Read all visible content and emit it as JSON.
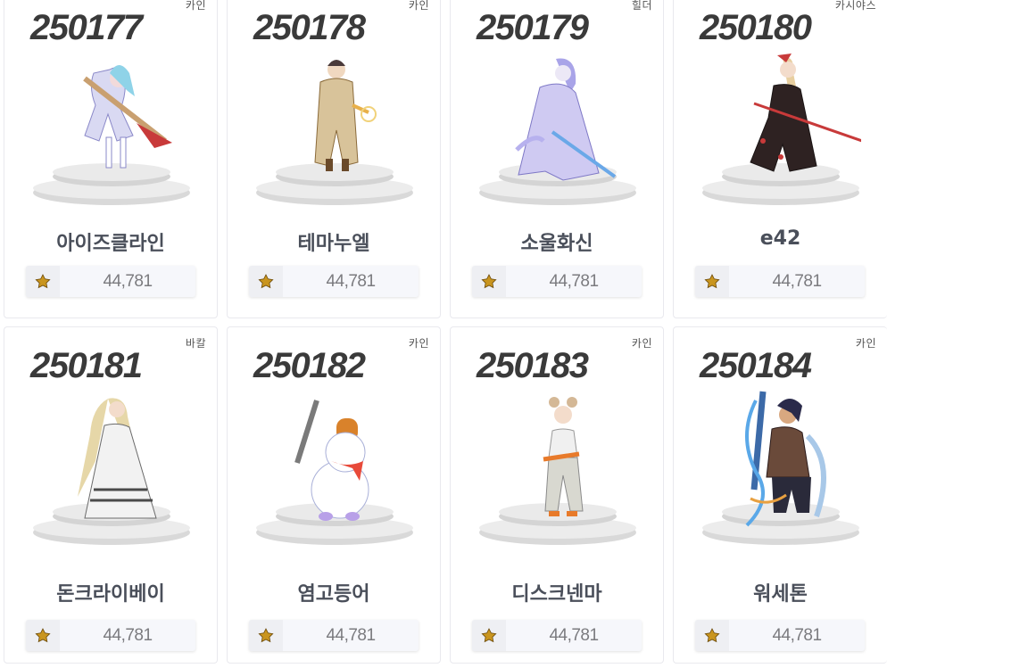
{
  "icons": {
    "medal": "gold-medal-icon"
  },
  "cards": [
    {
      "number": "250177",
      "server": "카인",
      "name": "아이즈클라인",
      "score": "44,781",
      "accent": "#b9b6e6"
    },
    {
      "number": "250178",
      "server": "카인",
      "name": "테마누엘",
      "score": "44,781",
      "accent": "#d8c39a"
    },
    {
      "number": "250179",
      "server": "힐더",
      "server_note": "partially visible",
      "name": "소울화신",
      "score": "44,781",
      "accent": "#a9a4e8"
    },
    {
      "number": "250180",
      "server": "카시야스",
      "name": "e42",
      "score": "44,781",
      "accent": "#3a2a2a"
    },
    {
      "number": "250181",
      "server": "바칼",
      "name": "돈크라이베이",
      "score": "44,781",
      "accent": "#e6d7a8"
    },
    {
      "number": "250182",
      "server": "카인",
      "name": "염고등어",
      "score": "44,781",
      "accent": "#e85a4a"
    },
    {
      "number": "250183",
      "server": "카인",
      "name": "디스크넨마",
      "score": "44,781",
      "accent": "#d4b896"
    },
    {
      "number": "250184",
      "server": "카인",
      "name": "워세톤",
      "score": "44,781",
      "accent": "#3c7ac8"
    }
  ]
}
